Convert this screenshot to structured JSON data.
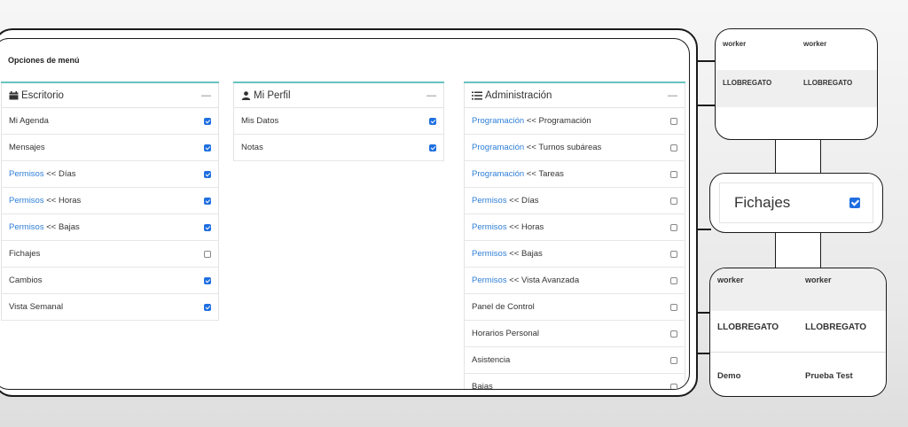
{
  "panel": {
    "title": "Opciones de menú"
  },
  "columns": [
    {
      "title": "Escritorio",
      "icon": "calendar-icon",
      "collapse": "—",
      "rows": [
        {
          "link": "",
          "text": "Mi Agenda",
          "checked": true
        },
        {
          "link": "",
          "text": "Mensajes",
          "checked": true
        },
        {
          "link": "Permisos",
          "text": " << Días",
          "checked": true
        },
        {
          "link": "Permisos",
          "text": " << Horas",
          "checked": true
        },
        {
          "link": "Permisos",
          "text": " << Bajas",
          "checked": true
        },
        {
          "link": "",
          "text": "Fichajes",
          "checked": false
        },
        {
          "link": "",
          "text": "Cambios",
          "checked": true
        },
        {
          "link": "",
          "text": "Vista Semanal",
          "checked": true
        }
      ]
    },
    {
      "title": "Mi Perfil",
      "icon": "user-icon",
      "collapse": "—",
      "rows": [
        {
          "link": "",
          "text": "Mis Datos",
          "checked": true
        },
        {
          "link": "",
          "text": "Notas",
          "checked": true
        }
      ]
    },
    {
      "title": "Administración",
      "icon": "list-icon",
      "collapse": "—",
      "rows": [
        {
          "link": "Programación",
          "text": " << Programación",
          "checked": false
        },
        {
          "link": "Programación",
          "text": " << Turnos subáreas",
          "checked": false
        },
        {
          "link": "Programación",
          "text": " << Tareas",
          "checked": false
        },
        {
          "link": "Permisos",
          "text": " << Días",
          "checked": false
        },
        {
          "link": "Permisos",
          "text": " << Horas",
          "checked": false
        },
        {
          "link": "Permisos",
          "text": " << Bajas",
          "checked": false
        },
        {
          "link": "Permisos",
          "text": " << Vista Avanzada",
          "checked": false
        },
        {
          "link": "",
          "text": "Panel de Control",
          "checked": false
        },
        {
          "link": "",
          "text": "Horarios Personal",
          "checked": false
        },
        {
          "link": "",
          "text": "Asistencia",
          "checked": false
        },
        {
          "link": "",
          "text": "Bajas",
          "checked": false
        }
      ]
    }
  ],
  "callout_top": {
    "role": [
      "worker",
      "worker"
    ],
    "center": [
      "LLOBREGATO",
      "LLOBREGATO"
    ]
  },
  "callout_mid": {
    "label": "Fichajes",
    "checked": true
  },
  "callout_bottom": {
    "role": [
      "worker",
      "worker"
    ],
    "center": [
      "LLOBREGATO",
      "LLOBREGATO"
    ],
    "name": [
      "Demo",
      "Prueba Test"
    ]
  },
  "colors": {
    "accent": "#67c3c0",
    "link": "#2f7fd6",
    "checkbox": "#1f6fe0"
  }
}
